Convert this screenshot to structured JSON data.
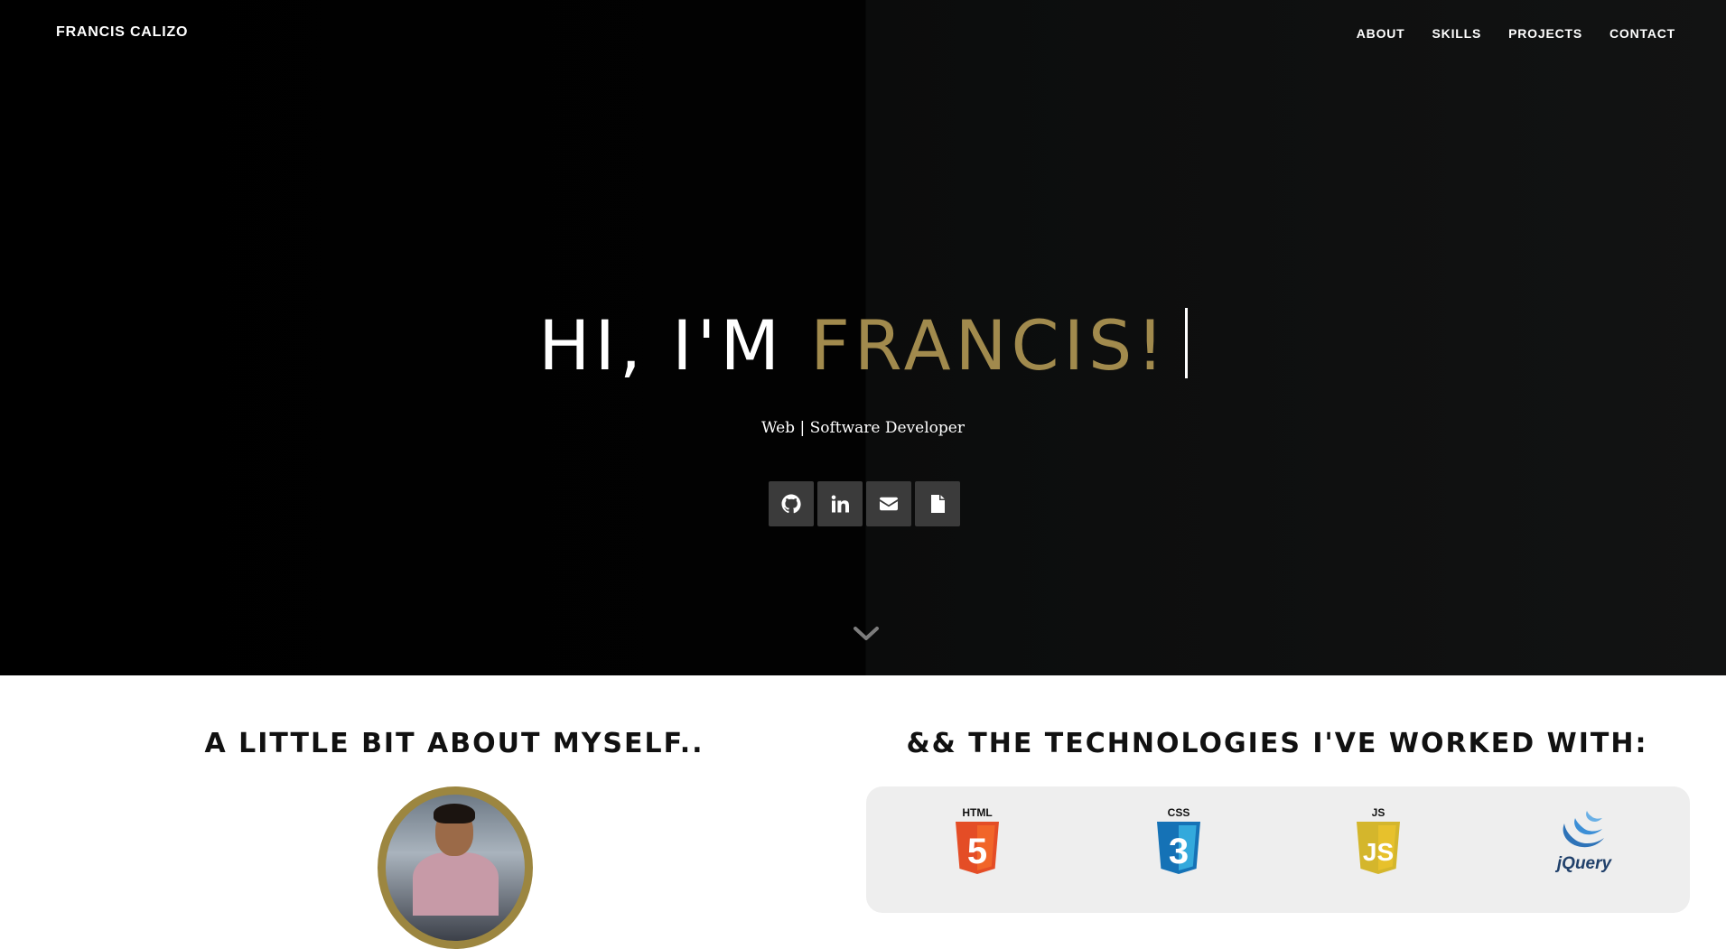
{
  "nav": {
    "brand": "FRANCIS CALIZO",
    "links": [
      "ABOUT",
      "SKILLS",
      "PROJECTS",
      "CONTACT"
    ]
  },
  "hero": {
    "greeting": "HI, I'M ",
    "name": "FRANCIS!",
    "subtitle": "Web | Software Developer",
    "social_icons": [
      "github-icon",
      "linkedin-icon",
      "envelope-icon",
      "document-icon"
    ],
    "scroll_icon": "chevron-down-icon"
  },
  "about": {
    "title": "A LITTLE BIT ABOUT MYSELF.."
  },
  "tech": {
    "title": "&& THE TECHNOLOGIES I'VE WORKED WITH:",
    "items": [
      {
        "label": "HTML",
        "glyph": "5",
        "color": "#e44d26"
      },
      {
        "label": "CSS",
        "glyph": "3",
        "color": "#2965f1"
      },
      {
        "label": "JS",
        "glyph": "JS",
        "color": "#e7c12c"
      },
      {
        "label": "jQuery",
        "color": "#21416b"
      }
    ]
  },
  "colors": {
    "accent": "#a18a4d",
    "hero_bg": "#000000",
    "social_bg": "#3b3b3b"
  }
}
